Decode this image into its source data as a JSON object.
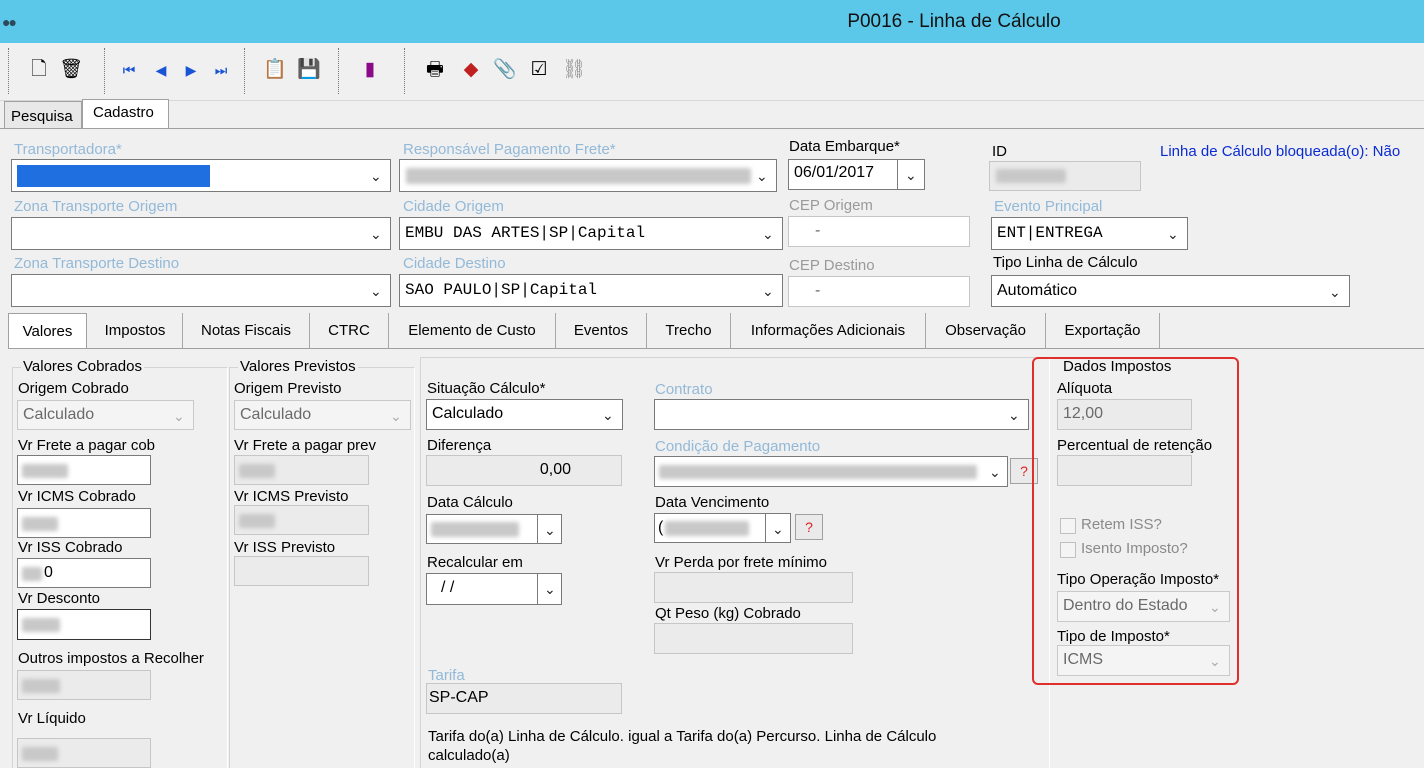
{
  "window": {
    "title": "P0016 - Linha de Cálculo"
  },
  "toolbar": {
    "icons": [
      "new-doc-icon",
      "delete-icon",
      "first-record-icon",
      "prev-record-icon",
      "next-record-icon",
      "last-record-icon",
      "report-icon",
      "save-icon",
      "chart-icon",
      "print-icon",
      "eraser-icon",
      "attach-icon",
      "checklist-icon",
      "link-icon"
    ]
  },
  "top_tabs": [
    "Pesquisa",
    "Cadastro"
  ],
  "form": {
    "transportadora_label": "Transportadora*",
    "resp_pagamento_label": "Responsável Pagamento Frete*",
    "data_embarque_label": "Data Embarque*",
    "data_embarque_value": "06/01/2017",
    "id_label": "ID",
    "bloqueada_text": "Linha de Cálculo bloqueada(o): Não",
    "zona_origem_label": "Zona Transporte Origem",
    "cidade_origem_label": "Cidade Origem",
    "cidade_origem_value": "EMBU DAS ARTES|SP|Capital",
    "cep_origem_label": "CEP Origem",
    "cep_origem_value": "-",
    "evento_principal_label": "Evento Principal",
    "evento_principal_value": "ENT|ENTREGA",
    "zona_destino_label": "Zona Transporte Destino",
    "cidade_destino_label": "Cidade Destino",
    "cidade_destino_value": "SAO PAULO|SP|Capital",
    "cep_destino_label": "CEP Destino",
    "cep_destino_value": "-",
    "tipo_linha_label": "Tipo Linha de Cálculo",
    "tipo_linha_value": "Automático"
  },
  "inner_tabs": [
    "Valores",
    "Impostos",
    "Notas Fiscais",
    "CTRC",
    "Elemento de Custo",
    "Eventos",
    "Trecho",
    "Informações Adicionais",
    "Observação",
    "Exportação"
  ],
  "valores_cobrados": {
    "group": "Valores Cobrados",
    "origem_label": "Origem Cobrado",
    "origem_value": "Calculado",
    "frete_label": "Vr Frete a pagar cob",
    "icms_label": "Vr ICMS Cobrado",
    "iss_label": "Vr ISS Cobrado",
    "iss_value_partial": "0",
    "desconto_label": "Vr Desconto",
    "outros_label": "Outros impostos a Recolher",
    "liquido_label": "Vr Líquido"
  },
  "valores_previstos": {
    "group": "Valores Previstos",
    "origem_label": "Origem Previsto",
    "origem_value": "Calculado",
    "frete_label": "Vr Frete a pagar prev",
    "icms_label": "Vr ICMS Previsto",
    "iss_label": "Vr ISS Previsto"
  },
  "middle": {
    "situacao_label": "Situação Cálculo*",
    "situacao_value": "Calculado",
    "diferenca_label": "Diferença",
    "diferenca_value": "0,00",
    "data_calculo_label": "Data Cálculo",
    "recalcular_label": "Recalcular em",
    "recalcular_value": "/ /",
    "contrato_label": "Contrato",
    "condicao_label": "Condição de Pagamento",
    "vencimento_label": "Data Vencimento",
    "vencimento_prefix": "(",
    "perda_label": "Vr Perda por frete mínimo",
    "peso_label": "Qt Peso (kg) Cobrado",
    "tarifa_label": "Tarifa",
    "tarifa_value": "SP-CAP",
    "tarifa_note": "Tarifa do(a) Linha de Cálculo. igual a Tarifa do(a) Percurso. Linha de Cálculo calculado(a)",
    "question_mark": "?"
  },
  "impostos": {
    "group": "Dados Impostos",
    "aliquota_label": "Alíquota",
    "aliquota_value": "12,00",
    "retencao_label": "Percentual de retenção",
    "retem_iss_label": "Retem ISS?",
    "isento_label": "Isento Imposto?",
    "tipo_operacao_label": "Tipo Operação Imposto*",
    "tipo_operacao_value": "Dentro do Estado",
    "tipo_imposto_label": "Tipo de Imposto*",
    "tipo_imposto_value": "ICMS"
  },
  "colors": {
    "titlebar": "#5bc8ea",
    "highlight_border": "#e0302c",
    "link": "#0a2bd4",
    "disabled_label": "#93b9d8"
  }
}
